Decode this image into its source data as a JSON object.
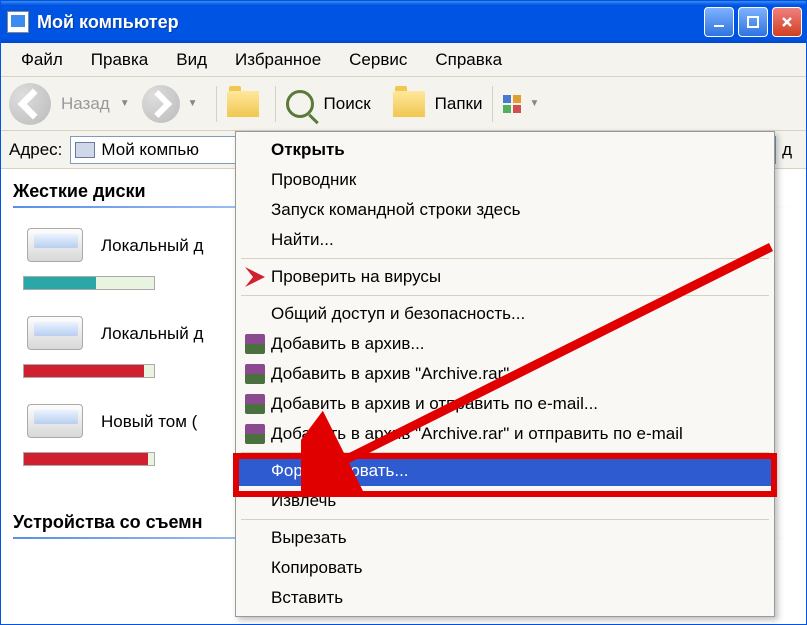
{
  "titlebar": {
    "title": "Мой компьютер"
  },
  "menu": {
    "file": "Файл",
    "edit": "Правка",
    "view": "Вид",
    "favorites": "Избранное",
    "tools": "Сервис",
    "help": "Справка"
  },
  "toolbar": {
    "back": "Назад",
    "search": "Поиск",
    "folders": "Папки"
  },
  "address": {
    "label": "Адрес:",
    "value": "Мой компью",
    "go_suffix": "д"
  },
  "sections": {
    "hdd": "Жесткие диски",
    "removable": "Устройства со съемн"
  },
  "drives": [
    {
      "label": "Локальный д",
      "bar_class": "teal",
      "used_pct": 55
    },
    {
      "label": "Локальный д",
      "bar_class": "red",
      "used_pct": 92
    },
    {
      "label": "Новый том (",
      "bar_class": "red",
      "used_pct": 95
    }
  ],
  "ctx": {
    "open": "Открыть",
    "explorer": "Проводник",
    "cmd_here": "Запуск командной строки здесь",
    "find": "Найти...",
    "virus_scan": "Проверить на вирусы",
    "sharing": "Общий доступ и безопасность...",
    "add_archive": "Добавить в архив...",
    "add_archive_rar": "Добавить в архив \"Archive.rar\"",
    "add_email": "Добавить в архив и отправить по e-mail...",
    "add_rar_email": "Добавить в архив \"Archive.rar\" и отправить по e-mail",
    "format": "Форматировать...",
    "eject": "Извлечь",
    "cut": "Вырезать",
    "copy": "Копировать",
    "paste": "Вставить"
  }
}
